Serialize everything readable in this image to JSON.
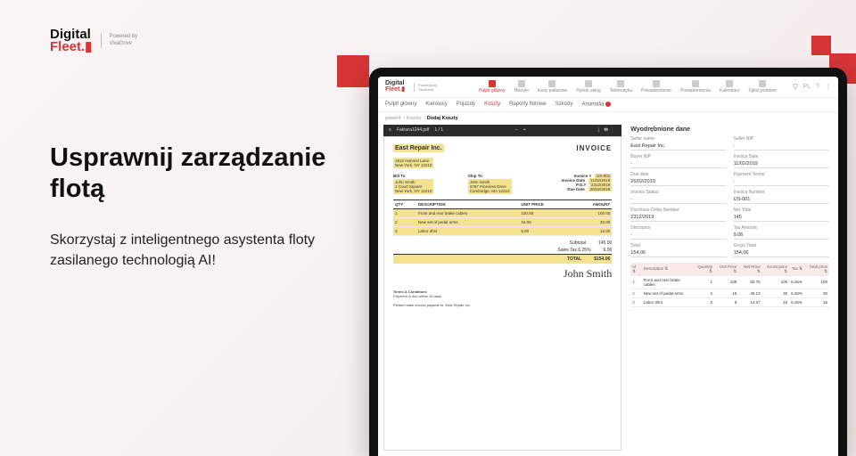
{
  "brand": {
    "line1": "Digital",
    "line2": "Fleet",
    "powered_label": "Powered by",
    "powered_name": "VivaDrive"
  },
  "hero": {
    "title": "Usprawnij zarządzanie flotą",
    "subtitle": "Skorzystaj z inteligentnego asystenta floty zasilanego technologią AI!"
  },
  "top_nav": {
    "items": [
      "Pulpit główny",
      "Metryki",
      "Karty paliwowe",
      "Rynek usług",
      "Telematyka",
      "Powiadomienie",
      "Powiadomienia",
      "Kalendarz",
      "Zgłoś problem"
    ],
    "active_index": 0
  },
  "top_right_icons": [
    "Q",
    "PL",
    "?",
    "⋮"
  ],
  "sub_nav": {
    "items": [
      "Pulpit główny",
      "Kierowcy",
      "Pojazdy",
      "Koszty",
      "Raporty flotowe",
      "Szkody",
      "Anomalia"
    ],
    "active_index": 3,
    "badge_index": 6
  },
  "breadcrumb": {
    "user": "pawel4",
    "section": "Koszty",
    "page": "Dodaj Koszty"
  },
  "pdf": {
    "filename": "Faktura1244.pdf",
    "page": "1 / 1",
    "icons": [
      "⤓",
      "🖶",
      "⋮"
    ]
  },
  "invoice": {
    "company": "East Repair Inc.",
    "title": "INVOICE",
    "company_addr": "1912 Harvest Lane\nNew York, NY 12210",
    "bill_to": {
      "label": "Bill To",
      "text": "John Smith\n2 Court Square\nNew York, NY 12210"
    },
    "ship_to": {
      "label": "Ship To",
      "text": "John Smith\n3787 Pineview Drive\nCambridge, MA 12210"
    },
    "meta": [
      {
        "k": "Invoice #",
        "v": "US-001"
      },
      {
        "k": "Invoice Date",
        "v": "11/02/2019"
      },
      {
        "k": "P.O.#",
        "v": "2312/2019"
      },
      {
        "k": "Due Date",
        "v": "26/02/2019"
      }
    ],
    "columns": [
      "QTY",
      "DESCRIPTION",
      "UNIT PRICE",
      "AMOUNT"
    ],
    "lines": [
      {
        "qty": "1",
        "desc": "Front and rear brake cables",
        "unit": "100.00",
        "amt": "100.00"
      },
      {
        "qty": "2",
        "desc": "New set of pedal arms",
        "unit": "15.00",
        "amt": "30.00"
      },
      {
        "qty": "3",
        "desc": "Labor 3hrs",
        "unit": "5.00",
        "amt": "15.00"
      }
    ],
    "subtotal": {
      "k": "Subtotal",
      "v": "145.00"
    },
    "tax": {
      "k": "Sales Tax 6.25%",
      "v": "9.06"
    },
    "total": {
      "k": "TOTAL",
      "v": "$154.06"
    },
    "signature": "John Smith",
    "terms_title": "Terms & Conditions",
    "terms_1": "Payment is due within 15 days",
    "terms_2": "Please make checks payable to: East Repair Inc."
  },
  "extracted": {
    "title": "Wyodrębnione dane",
    "fields": [
      {
        "label": "Seller name",
        "value": "East Repair Inc."
      },
      {
        "label": "Seller NIP",
        "value": "-"
      },
      {
        "label": "Buyer NIP",
        "value": "-"
      },
      {
        "label": "Invoice Date",
        "value": "11/02/2019"
      },
      {
        "label": "Due date",
        "value": "26/02/2019"
      },
      {
        "label": "Payment Terms",
        "value": "-"
      },
      {
        "label": "Invoice Status",
        "value": "-"
      },
      {
        "label": "Invoice Number",
        "value": "US-001"
      },
      {
        "label": "Purchase Order Number",
        "value": "2312/2019"
      },
      {
        "label": "Net Total",
        "value": "145"
      },
      {
        "label": "Discounts",
        "value": "-"
      },
      {
        "label": "Tax Amount",
        "value": "9.06"
      },
      {
        "label": "Total",
        "value": "154,06"
      },
      {
        "label": "Gross Total",
        "value": "154,06"
      }
    ],
    "line_headers": [
      "Id",
      "Description",
      "Quantity",
      "Unit Price",
      "Net Price",
      "Gross price",
      "Tax",
      "Total price"
    ],
    "lines": [
      [
        "1",
        "Front and rear brake cables",
        "1",
        "100",
        "93.75",
        "100",
        "6.25%",
        "100"
      ],
      [
        "2",
        "New set of pedal arms",
        "2",
        "15",
        "28.13",
        "30",
        "6.25%",
        "30"
      ],
      [
        "3",
        "Labor 3hrs",
        "3",
        "5",
        "14.07",
        "15",
        "6.25%",
        "15"
      ]
    ]
  }
}
